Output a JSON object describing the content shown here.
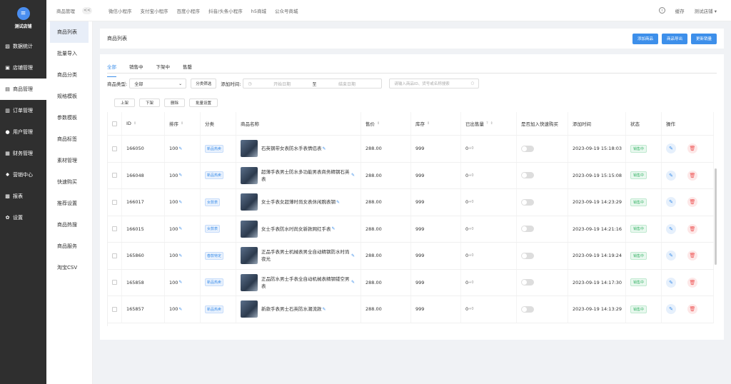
{
  "sidebar": {
    "logo_icon": "≡",
    "store_name": "测试店铺",
    "items": [
      {
        "icon": "chart-icon",
        "glyph": "▨",
        "label": "数据统计"
      },
      {
        "icon": "store-icon",
        "glyph": "▣",
        "label": "店铺管理"
      },
      {
        "icon": "goods-icon",
        "glyph": "▤",
        "label": "商品管理"
      },
      {
        "icon": "order-icon",
        "glyph": "▥",
        "label": "订单管理"
      },
      {
        "icon": "user-icon",
        "glyph": "●",
        "label": "用户管理"
      },
      {
        "icon": "finance-icon",
        "glyph": "▦",
        "label": "财务管理"
      },
      {
        "icon": "marketing-icon",
        "glyph": "✸",
        "label": "营销中心"
      },
      {
        "icon": "report-icon",
        "glyph": "▩",
        "label": "报表"
      },
      {
        "icon": "settings-icon",
        "glyph": "✿",
        "label": "设置"
      }
    ]
  },
  "subnav": {
    "items": [
      "商品列表",
      "批量导入",
      "商品分类",
      "规格模板",
      "参数模板",
      "商品标签",
      "素材管理",
      "快速购买",
      "推荐设置",
      "商品热搜",
      "商品服务",
      "淘宝CSV"
    ]
  },
  "topbar": {
    "breadcrumb": "商品管理",
    "collapse": "<<",
    "tabs": [
      "微信小程序",
      "支付宝小程序",
      "百度小程序",
      "抖音/头条小程序",
      "h5商城",
      "公众号商城"
    ],
    "cache_label": "缓存",
    "store_label": "测试店铺",
    "info_glyph": "i",
    "dropdown_glyph": "▾"
  },
  "title_card": {
    "title": "商品列表",
    "actions": [
      "添加商品",
      "商品导出",
      "更新销量"
    ]
  },
  "status_tabs": [
    "全部",
    "销售中",
    "下架中",
    "售罄"
  ],
  "filters": {
    "type_label": "商品类型:",
    "type_value": "全部",
    "category_button": "分类筛选",
    "time_label": "添加时间:",
    "start_placeholder": "开始日期",
    "end_placeholder": "结束日期",
    "range_sep": "至",
    "search_placeholder": "请输入商品ID、货号或名称搜索",
    "chevron": "⌄",
    "search_glyph": "○",
    "calendar_glyph": "◷"
  },
  "bulk_actions": [
    "上架",
    "下架",
    "删除",
    "批量设置"
  ],
  "table": {
    "headers": {
      "id": "ID",
      "sort": "排序",
      "category": "分类",
      "name": "商品名称",
      "price": "售价",
      "stock": "库存",
      "sold": "已出售量",
      "quick": "是否加入快速购买",
      "time": "添加时间",
      "status": "状态",
      "ops": "操作"
    },
    "sort_glyph": "⇕",
    "help_glyph": "?",
    "edit_glyph": "✎",
    "delete_glyph": "🗑",
    "rows": [
      {
        "id": "166050",
        "sort": "100",
        "category": "新品热卖",
        "name": "石英钢带女表防水手表情侣表",
        "price": "288.00",
        "stock": "999",
        "sold": "0",
        "sold_plus": "+0",
        "time": "2023-09-19 15:18:03",
        "status": "销售中"
      },
      {
        "id": "166048",
        "sort": "100",
        "category": "新品热卖",
        "name": "超薄手表男士防水多功能男表商务精钢石英表",
        "price": "288.00",
        "stock": "999",
        "sold": "0",
        "sold_plus": "+0",
        "time": "2023-09-19 15:15:08",
        "status": "销售中"
      },
      {
        "id": "166017",
        "sort": "100",
        "category": "女款表",
        "name": "女士手表女超薄时尚女表休闲腕表钢",
        "price": "288.00",
        "stock": "999",
        "sold": "0",
        "sold_plus": "+0",
        "time": "2023-09-19 14:23:29",
        "status": "销售中"
      },
      {
        "id": "166015",
        "sort": "100",
        "category": "女款表",
        "name": "女士手表防水时尚女新款网红手表",
        "price": "288.00",
        "stock": "999",
        "sold": "0",
        "sold_plus": "+0",
        "time": "2023-09-19 14:21:16",
        "status": "销售中"
      },
      {
        "id": "165860",
        "sort": "100",
        "category": "春款特定",
        "name": "正品手表男士机械表男全自动精钢防水时尚夜光",
        "price": "288.00",
        "stock": "999",
        "sold": "0",
        "sold_plus": "+0",
        "time": "2023-09-19 14:19:24",
        "status": "销售中"
      },
      {
        "id": "165858",
        "sort": "100",
        "category": "新品热卖",
        "name": "正品防水男士手表全自动机械表精钢镂空男表",
        "price": "288.00",
        "stock": "999",
        "sold": "0",
        "sold_plus": "+0",
        "time": "2023-09-19 14:17:30",
        "status": "销售中"
      },
      {
        "id": "165857",
        "sort": "100",
        "category": "新品热卖",
        "name": "新款手表男士石英防水潮流款",
        "price": "288.00",
        "stock": "999",
        "sold": "0",
        "sold_plus": "+0",
        "time": "2023-09-19 14:13:29",
        "status": "销售中"
      }
    ]
  },
  "colors": {
    "primary": "#3d8fea",
    "sidebar_bg": "#2f2f2f",
    "success": "#3bb56a",
    "danger": "#e55555"
  }
}
